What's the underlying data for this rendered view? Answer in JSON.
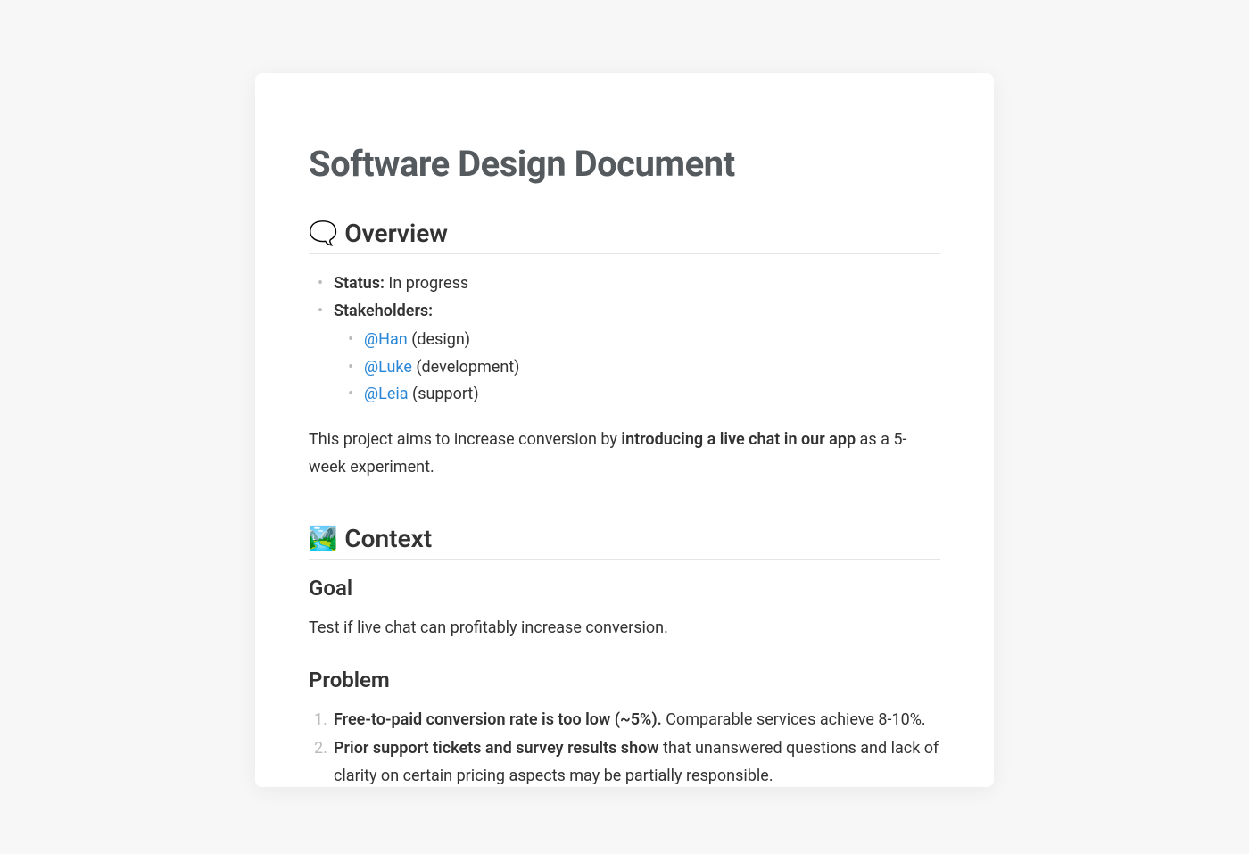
{
  "title": "Software Design Document",
  "overview": {
    "heading": "Overview",
    "emoji": "🗨️",
    "status_label": "Status:",
    "status_value": " In progress",
    "stakeholders_label": "Stakeholders:",
    "stakeholders": [
      {
        "mention": "@Han",
        "role": " (design)"
      },
      {
        "mention": "@Luke",
        "role": " (development)"
      },
      {
        "mention": "@Leia",
        "role": " (support)"
      }
    ],
    "summary_before": "This project aims to increase conversion by ",
    "summary_bold": "introducing a live chat in our app",
    "summary_after": " as a 5-week experiment."
  },
  "context": {
    "heading": "Context",
    "emoji": "🏞️",
    "goal_heading": "Goal",
    "goal_text": "Test if live chat can profitably increase conversion.",
    "problem_heading": "Problem",
    "problems": [
      {
        "bold": "Free-to-paid conversion rate is too low (~5%).",
        "rest": " Comparable services achieve 8-10%."
      },
      {
        "bold": "Prior support tickets and survey results show",
        "rest": " that unanswered questions and lack of clarity on certain pricing aspects may be partially responsible."
      }
    ]
  }
}
